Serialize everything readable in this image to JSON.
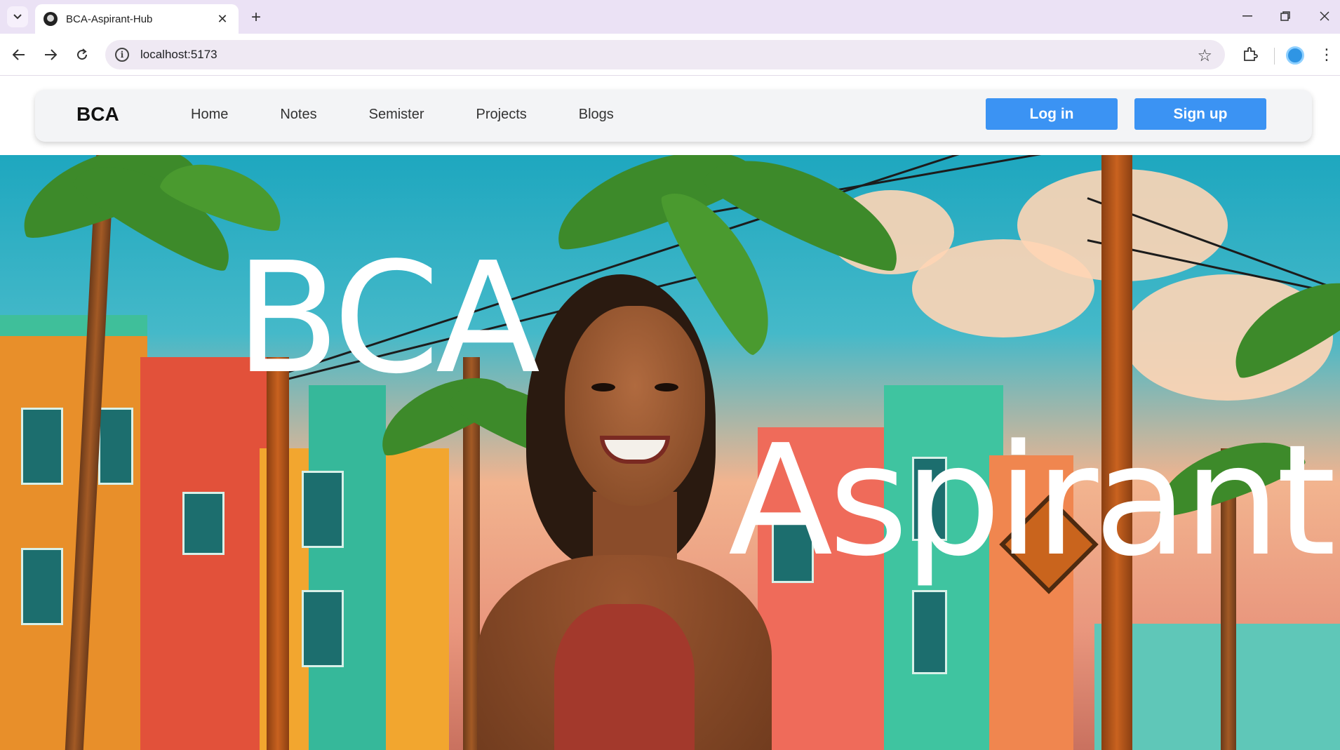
{
  "browser": {
    "tab_title": "BCA-Aspirant-Hub",
    "url": "localhost:5173"
  },
  "navbar": {
    "brand": "BCA",
    "links": [
      "Home",
      "Notes",
      "Semister",
      "Projects",
      "Blogs"
    ],
    "login_label": "Log in",
    "signup_label": "Sign up",
    "accent_color": "#3b93f3"
  },
  "hero": {
    "title_line1": "BCA",
    "title_line2": "Aspirant"
  },
  "icons": [
    "tab-search-icon",
    "close-icon",
    "new-tab-icon",
    "minimize-icon",
    "restore-icon",
    "back-icon",
    "forward-icon",
    "reload-icon",
    "info-icon",
    "star-icon",
    "extensions-icon",
    "profile-icon",
    "menu-icon"
  ]
}
